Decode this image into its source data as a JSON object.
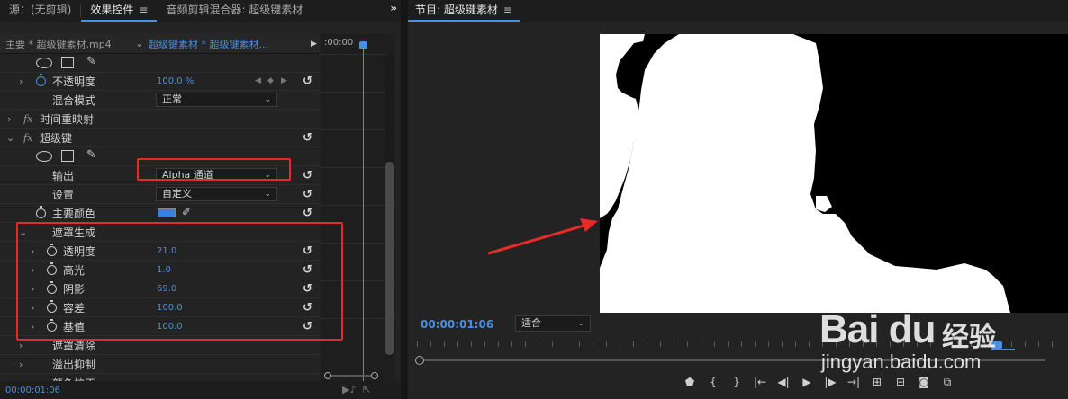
{
  "tabs": {
    "source": "源：(无剪辑)",
    "effect_controls": "效果控件",
    "audio_mixer": "音频剪辑混合器: 超级键素材",
    "menu_icon": "≡",
    "overflow": "»"
  },
  "clip_bar": {
    "master": "主要 * 超级键素材.mp4",
    "sequence": "超级键素材 * 超级键素材...",
    "timecode": ":00:00"
  },
  "properties": {
    "opacity_label": "不透明度",
    "opacity_value": "100.0 %",
    "blend_mode_label": "混合模式",
    "blend_mode_value": "正常",
    "time_remap_label": "时间重映射",
    "ultra_key_label": "超级键",
    "output_label": "输出",
    "output_value": "Alpha 通道",
    "setting_label": "设置",
    "setting_value": "自定义",
    "key_color_label": "主要颜色",
    "key_color": "#3a7fe0",
    "matte_gen_label": "遮罩生成",
    "transparency_label": "透明度",
    "transparency_value": "21.0",
    "highlight_label": "高光",
    "highlight_value": "1.0",
    "shadow_label": "阴影",
    "shadow_value": "69.0",
    "tolerance_label": "容差",
    "tolerance_value": "100.0",
    "pedestal_label": "基值",
    "pedestal_value": "100.0",
    "matte_cleanup_label": "遮罩清除",
    "spill_label": "溢出抑制",
    "color_correction_label": "颜色校正",
    "fx": "fx"
  },
  "left_bottom": {
    "timecode": "00:00:01:06"
  },
  "program": {
    "title": "节目: 超级键素材",
    "menu_icon": "≡",
    "timecode": "00:00:01:06",
    "fit_label": "适合"
  },
  "watermark": {
    "brand": "Bai du",
    "cn": "经验",
    "url": "jingyan.baidu.com"
  }
}
